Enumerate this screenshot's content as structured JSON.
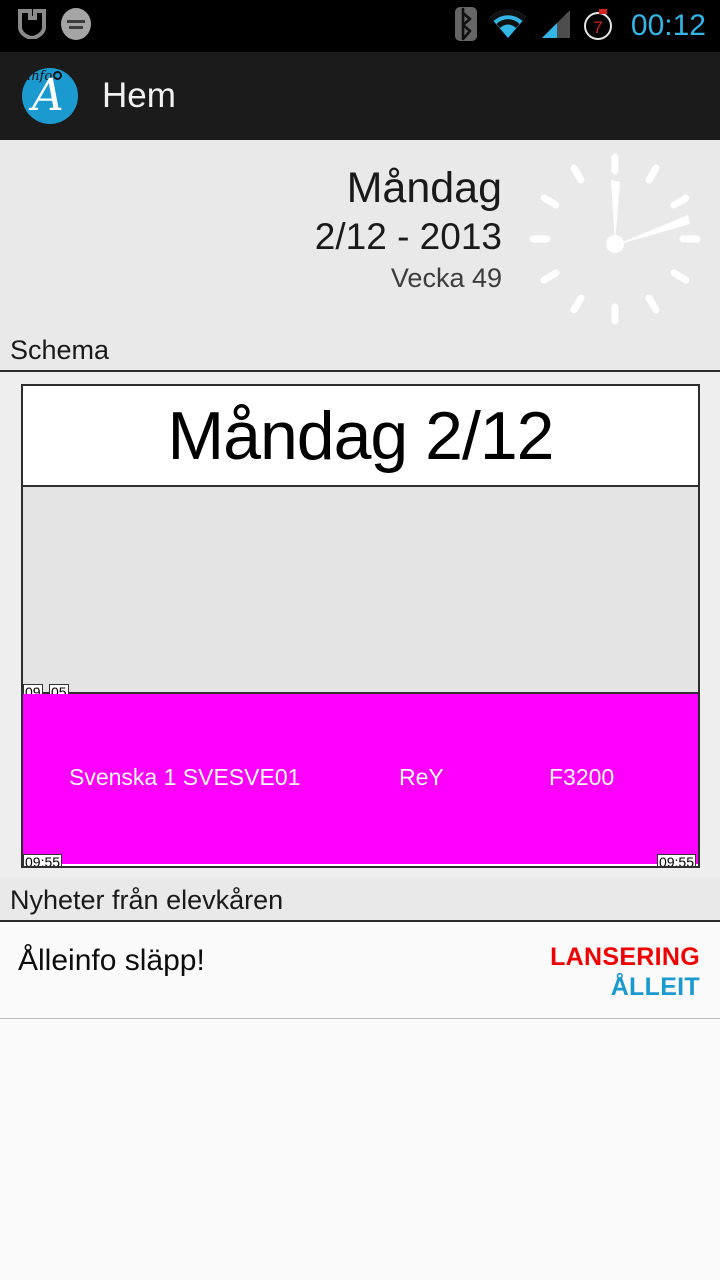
{
  "status_bar": {
    "icons_left": [
      "shield-logo-icon",
      "circular-badge-icon"
    ],
    "icons_right": [
      "bluetooth-icon",
      "wifi-icon",
      "cellular-signal-icon",
      "alarm-timer-icon"
    ],
    "alarm_count": "7",
    "clock": "00:12",
    "clock_color": "#33b5e5"
  },
  "action_bar": {
    "logo_icon": "alleinfo-app-icon",
    "logo_text_small": "info",
    "logo_letter": "A",
    "title": "Hem"
  },
  "date_panel": {
    "weekday": "Måndag",
    "date": "2/12 - 2013",
    "week": "Vecka 49",
    "clock_icon": "analog-clock-icon",
    "background": "#e9e9e9"
  },
  "sections": {
    "schema_header": "Schema",
    "news_header": "Nyheter från elevkåren"
  },
  "schedule": {
    "day_header": "Måndag 2/12",
    "free_block": {
      "time_label_hour": "09",
      "time_label_minute": "05"
    },
    "lesson": {
      "subject": "Svenska 1 SVESVE01",
      "teacher": "ReY",
      "room": "F3200",
      "color": "#ff00ff",
      "time_end_left": "09:55",
      "time_end_right": "09:55"
    }
  },
  "news": {
    "items": [
      {
        "title": "Ålleinfo släpp!",
        "tag_primary": "LANSERING",
        "tag_primary_color": "#ee0000",
        "tag_secondary": "ÅLLEIT",
        "tag_secondary_color": "#1b9ad0"
      }
    ]
  }
}
